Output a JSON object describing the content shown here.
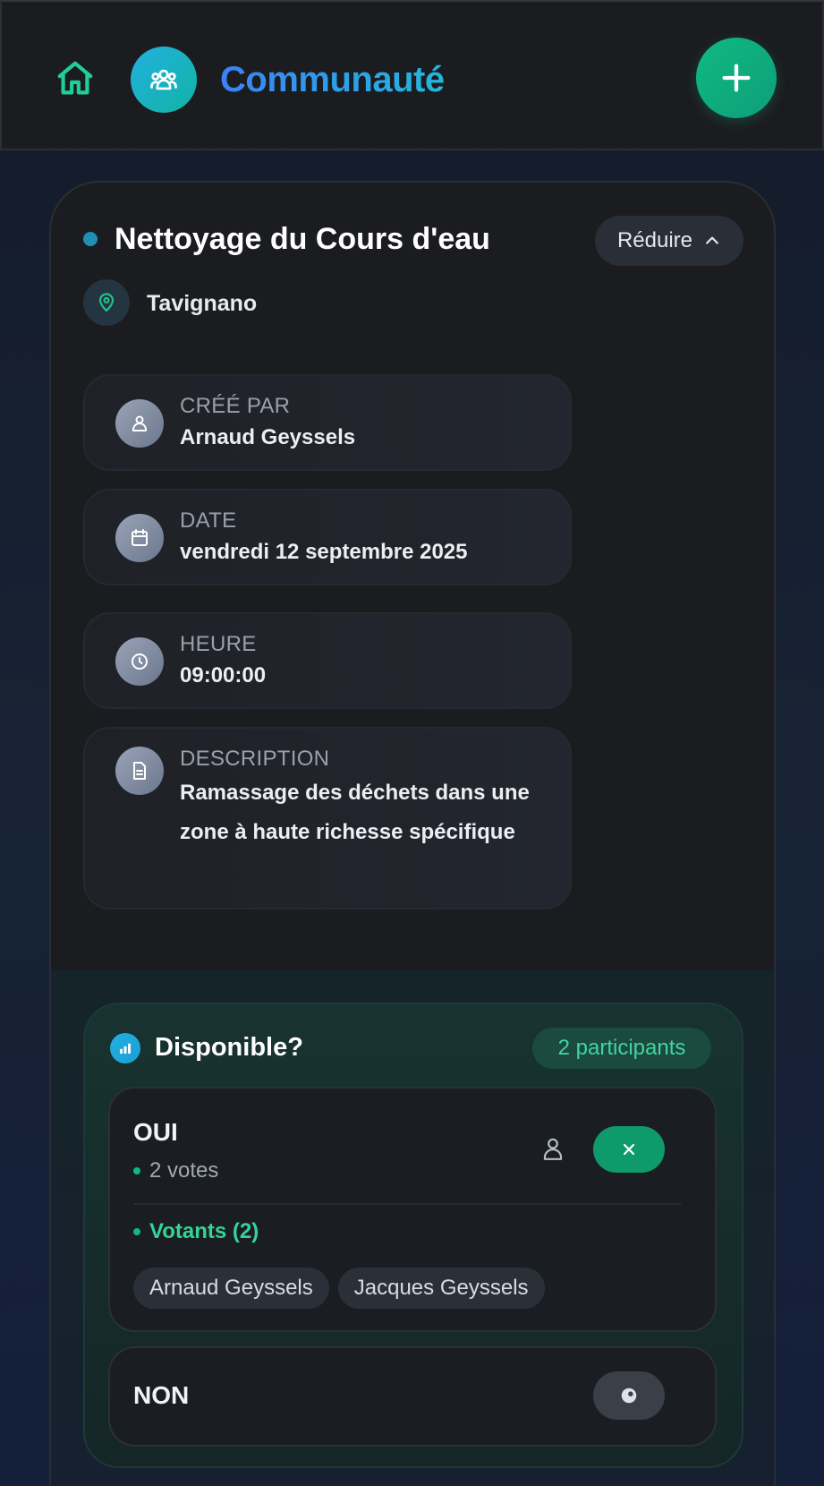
{
  "header": {
    "title": "Communauté",
    "icons": {
      "home": "home-icon",
      "community": "users-group-icon",
      "add": "plus-icon"
    },
    "accent_gradient": [
      "#3b82f6",
      "#23b7dc"
    ],
    "add_button_color": "#10b981"
  },
  "event": {
    "title": "Nettoyage du Cours d'eau",
    "collapse_label": "Réduire",
    "location": "Tavignano",
    "status_color": "#1f8fb4",
    "details": {
      "creator_label": "CRÉÉ PAR",
      "creator_value": "Arnaud Geyssels",
      "date_label": "DATE",
      "date_value": "vendredi 12 septembre 2025",
      "time_label": "HEURE",
      "time_value": "09:00:00",
      "description_label": "DESCRIPTION",
      "description_value": "Ramassage des déchets dans une zone à haute richesse spécifique"
    }
  },
  "poll": {
    "question": "Disponible?",
    "participants_badge": "2 participants",
    "options": [
      {
        "label": "OUI",
        "votes_text": "2 votes",
        "voters_heading": "Votants (2)",
        "voters": [
          "Arnaud Geyssels",
          "Jacques Geyssels"
        ],
        "selected": true
      },
      {
        "label": "NON",
        "selected": false
      }
    ],
    "colors": {
      "positive": "#10b981",
      "badge_text": "#40d6a0"
    }
  }
}
